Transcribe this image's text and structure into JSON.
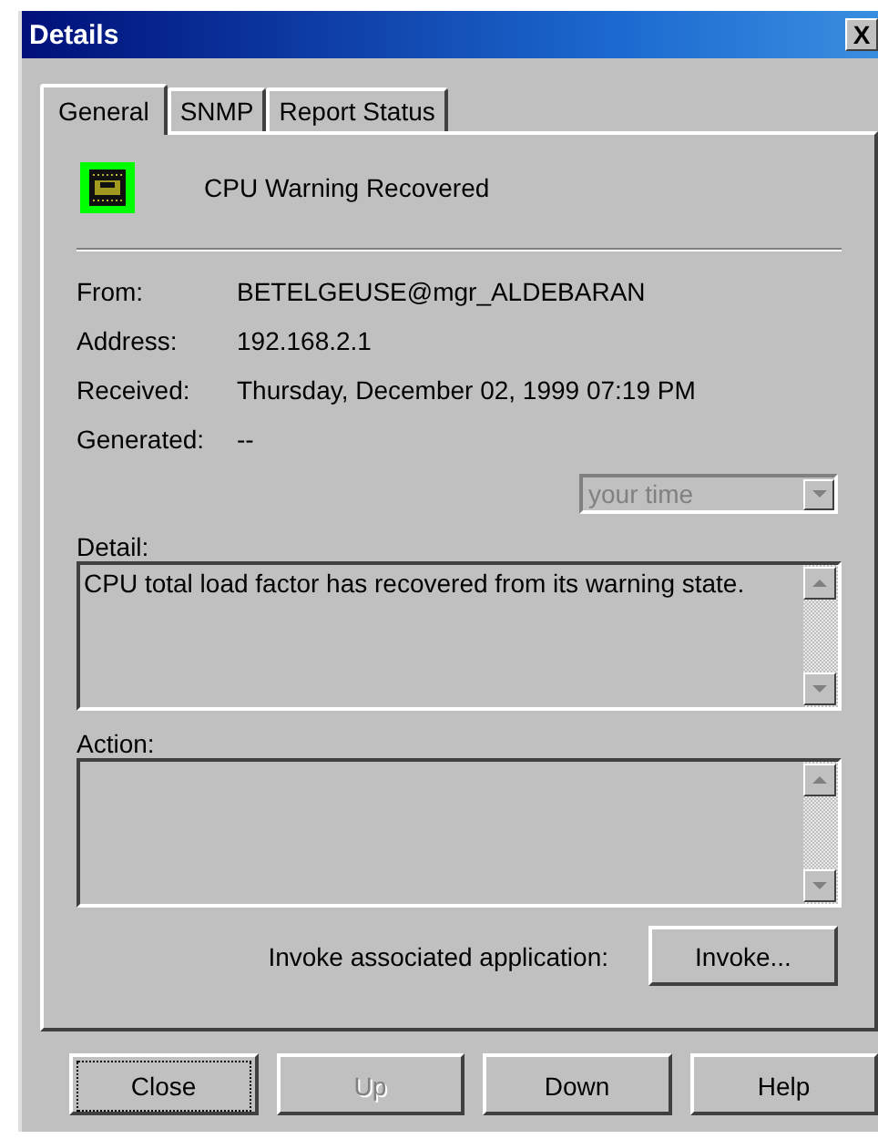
{
  "window": {
    "title": "Details",
    "close_glyph": "X"
  },
  "tabs": [
    {
      "label": "General",
      "selected": true
    },
    {
      "label": "SNMP",
      "selected": false
    },
    {
      "label": "Report Status",
      "selected": false
    }
  ],
  "event": {
    "title": "CPU Warning Recovered"
  },
  "fields": [
    {
      "label": "From:",
      "value": "BETELGEUSE@mgr_ALDEBARAN"
    },
    {
      "label": "Address:",
      "value": "192.168.2.1"
    },
    {
      "label": "Received:",
      "value": "Thursday, December 02, 1999 07:19 PM"
    },
    {
      "label": "Generated:",
      "value": "--"
    }
  ],
  "time_zone": {
    "value": "your time",
    "disabled": true
  },
  "detail": {
    "label": "Detail:",
    "value": "CPU total load factor has recovered from its warning state."
  },
  "action": {
    "label": "Action:"
  },
  "invoke": {
    "label": "Invoke associated application:",
    "button": "Invoke..."
  },
  "buttons": [
    {
      "label": "Close",
      "disabled": false,
      "focused": true
    },
    {
      "label": "Up",
      "disabled": true,
      "focused": false
    },
    {
      "label": "Down",
      "disabled": false,
      "focused": false
    },
    {
      "label": "Help",
      "disabled": false,
      "focused": false
    }
  ]
}
